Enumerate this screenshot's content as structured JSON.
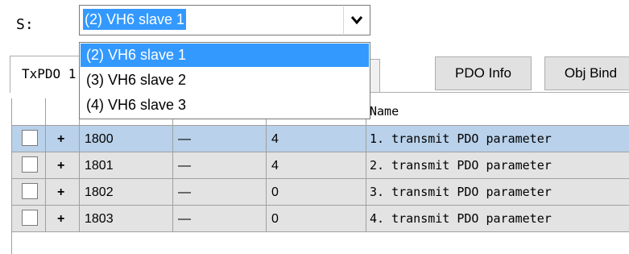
{
  "slave_label": "S:",
  "combo": {
    "selected": "(2)  VH6 slave 1"
  },
  "dropdown": {
    "options": [
      {
        "label": "(2)  VH6 slave 1",
        "selected": true
      },
      {
        "label": "(3)  VH6 slave 2",
        "selected": false
      },
      {
        "label": "(4)  VH6 slave 3",
        "selected": false
      }
    ]
  },
  "tabs": {
    "txpdo_label": "TxPDO 1"
  },
  "buttons": {
    "pdo_info": "PDO Info",
    "obj_bind": "Obj Bind"
  },
  "grid": {
    "name_header": "Name",
    "rows": [
      {
        "expand": "+",
        "index": "1800",
        "subindex": "—",
        "bytes": "4",
        "name": "1. transmit PDO parameter",
        "selected": true
      },
      {
        "expand": "+",
        "index": "1801",
        "subindex": "—",
        "bytes": "4",
        "name": "2. transmit PDO parameter",
        "selected": false
      },
      {
        "expand": "+",
        "index": "1802",
        "subindex": "—",
        "bytes": "0",
        "name": "3. transmit PDO parameter",
        "selected": false
      },
      {
        "expand": "+",
        "index": "1803",
        "subindex": "—",
        "bytes": "0",
        "name": "4. transmit PDO parameter",
        "selected": false
      }
    ]
  },
  "colors": {
    "selection": "#3399ff",
    "row_selected": "#b9d1ea",
    "row_normal": "#e3e3e3"
  },
  "icons": {
    "combo_arrow": "chevron-down-icon"
  }
}
